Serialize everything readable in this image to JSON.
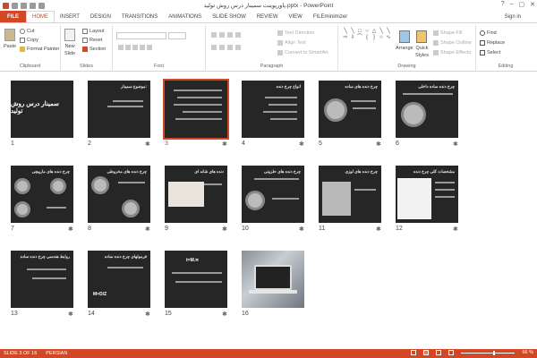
{
  "window": {
    "title": "پاورپوینت سمینار درس روش تولید.pptx - PowerPoint",
    "minimize": "–",
    "restore": "▢",
    "close": "✕",
    "help": "?"
  },
  "tabs": [
    {
      "label": "FILE"
    },
    {
      "label": "HOME"
    },
    {
      "label": "INSERT"
    },
    {
      "label": "DESIGN"
    },
    {
      "label": "TRANSITIONS"
    },
    {
      "label": "ANIMATIONS"
    },
    {
      "label": "SLIDE SHOW"
    },
    {
      "label": "REVIEW"
    },
    {
      "label": "VIEW"
    },
    {
      "label": "FILEminimizer"
    }
  ],
  "signin": "Sign in",
  "ribbon": {
    "clipboard": {
      "label": "Clipboard",
      "paste": "Paste",
      "cut": "Cut",
      "copy": "Copy",
      "format_painter": "Format Painter"
    },
    "slides": {
      "label": "Slides",
      "new_slide": "New",
      "new_slide2": "Slide",
      "layout": "Layout",
      "reset": "Reset",
      "section": "Section"
    },
    "font": {
      "label": "Font"
    },
    "paragraph": {
      "label": "Paragraph",
      "text_direction": "Text Direction",
      "align_text": "Align Text",
      "convert": "Convert to SmartArt"
    },
    "drawing": {
      "label": "Drawing",
      "arrange": "Arrange",
      "quick_styles": "Quick",
      "quick_styles2": "Styles",
      "shape_fill": "Shape Fill",
      "shape_outline": "Shape Outline",
      "shape_effects": "Shape Effects"
    },
    "editing": {
      "label": "Editing",
      "find": "Find",
      "replace": "Replace",
      "select": "Select"
    }
  },
  "slides": [
    {
      "num": "1",
      "title": "",
      "big": "سمینار درس روش تولید",
      "star": false
    },
    {
      "num": "2",
      "title": "موضوع سمینار:",
      "big": "",
      "star": true
    },
    {
      "num": "3",
      "title": "",
      "big": "",
      "star": true,
      "selected": true
    },
    {
      "num": "4",
      "title": "انواع چرخ دنده",
      "big": "",
      "star": true
    },
    {
      "num": "5",
      "title": "چرخ دنده های ساده",
      "big": "",
      "star": true
    },
    {
      "num": "6",
      "title": "چرخ دنده ساده داخلی",
      "big": "",
      "star": true
    },
    {
      "num": "7",
      "title": "چرخ دنده های مارپیچی",
      "big": "",
      "star": true
    },
    {
      "num": "8",
      "title": "چرخ دنده های مخروطی",
      "big": "",
      "star": true
    },
    {
      "num": "9",
      "title": "دنده های شانه ای",
      "big": "",
      "star": true
    },
    {
      "num": "10",
      "title": "چرخ دنده های حلزونی",
      "big": "",
      "star": true
    },
    {
      "num": "11",
      "title": "چرخ دنده های لوزی",
      "big": "",
      "star": true
    },
    {
      "num": "12",
      "title": "مشخصات کلی چرخ دنده",
      "big": "",
      "star": true
    },
    {
      "num": "13",
      "title": "روابط هندسی چرخ دنده ساده",
      "big": "",
      "star": true
    },
    {
      "num": "14",
      "title": "فرمولهای چرخ دنده ساده",
      "big": "M=D/Z",
      "star": true
    },
    {
      "num": "15",
      "title": "",
      "big": "t=M.π",
      "star": true
    },
    {
      "num": "16",
      "title": "",
      "big": "",
      "star": false
    }
  ],
  "star_glyph": "✱",
  "status": {
    "slide": "SLIDE 3 OF 16",
    "language": "PERSIAN",
    "zoom": "66 %"
  }
}
